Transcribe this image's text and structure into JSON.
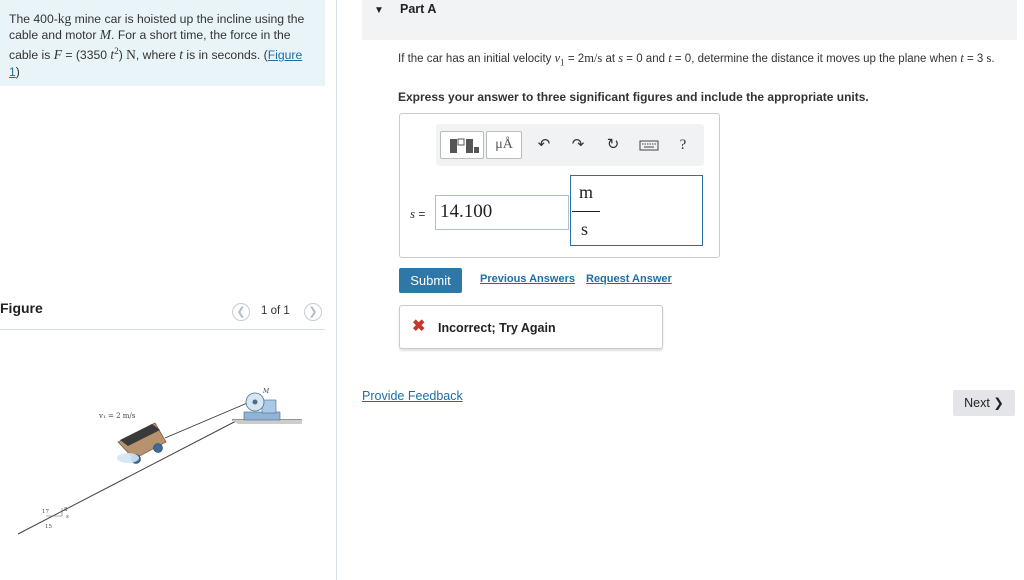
{
  "problem": {
    "t1": "The 400-",
    "mass_unit": "kg",
    "t2": " mine car is hoisted up the incline using the cable and motor ",
    "motor_sym": "M",
    "t3": ". For a short time, the force in the cable is ",
    "force_sym": "F",
    "t4": " = (3350 ",
    "t_sym": "t",
    "t_exp": "2",
    "t5": ") ",
    "force_unit": "N",
    "t6": ", where ",
    "t_sym2": "t",
    "t7": " is in seconds. (",
    "figure_link": "Figure 1",
    "t8": ")"
  },
  "figure": {
    "title": "Figure",
    "count": "1 of 1",
    "prev_icon": "chevron-left",
    "next_icon": "chevron-right",
    "velocity_label": "v₁ = 2 m/s",
    "motor_label": "M",
    "slope_hyp": "17",
    "slope_rise": "8",
    "slope_run": "15",
    "s_label": "s"
  },
  "part": {
    "caret_icon": "caret-down",
    "title": "Part A"
  },
  "question": {
    "q1": "If the car has an initial velocity ",
    "v_sym": "v",
    "v_sub": "1",
    "q2": " = 2",
    "v_unit": "m/s",
    "q3": " at ",
    "s_sym": "s",
    "q4": " = 0 and ",
    "t_sym": "t",
    "q5": " = 0, determine the distance it moves up the plane when ",
    "t_sym2": "t",
    "q6": " = 3 ",
    "t_unit": "s",
    "q7": "."
  },
  "instruction": "Express your answer to three significant figures and include the appropriate units.",
  "toolbar": {
    "units_label": "μÅ",
    "help_label": "?",
    "icons": [
      "templates-icon",
      "units-icon",
      "undo-icon",
      "redo-icon",
      "reset-icon",
      "keyboard-icon",
      "help-icon"
    ]
  },
  "answer": {
    "var": "s",
    "eq": " =",
    "value": "14.100",
    "unit_num": "m",
    "unit_den": "s"
  },
  "actions": {
    "submit": "Submit",
    "previous_answers": "Previous Answers",
    "request_answer": "Request Answer"
  },
  "feedback": {
    "status": "Incorrect; Try Again",
    "icon": "x-icon"
  },
  "provide_feedback": "Provide Feedback",
  "next": "Next",
  "colors": {
    "accent": "#2e77a7",
    "link": "#1b6fa8",
    "error": "#c0392b",
    "problem_bg": "#e9f4f8"
  }
}
